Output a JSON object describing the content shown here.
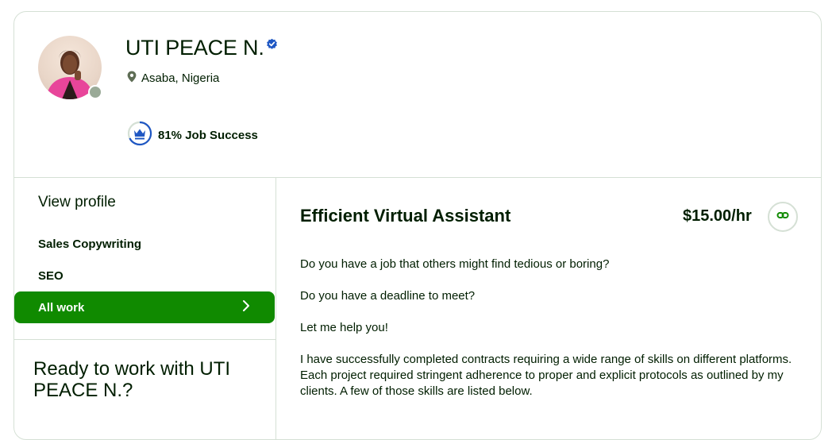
{
  "profile": {
    "name": "UTI PEACE N.",
    "location": "Asaba, Nigeria",
    "job_success": "81% Job Success"
  },
  "sidebar": {
    "view_profile": "View profile",
    "items": [
      {
        "label": "Sales Copywriting"
      },
      {
        "label": "SEO"
      },
      {
        "label": "All work"
      }
    ],
    "ready_title": "Ready to work with UTI PEACE N.?"
  },
  "main": {
    "title": "Efficient Virtual Assistant",
    "rate": "$15.00/hr",
    "description": [
      "Do you have a job that others might find tedious or boring?",
      "Do you have a deadline to meet?",
      "Let me help you!",
      "I have successfully completed contracts requiring a wide range of skills on different platforms. Each project required stringent adherence to proper and explicit protocols as outlined by my clients. A few of those skills are listed below."
    ]
  },
  "colors": {
    "brand_green": "#108a00",
    "verified_blue": "#1f57c3",
    "border": "#d5e0d5",
    "text": "#001e00"
  },
  "icons": [
    "verified-badge-icon",
    "location-pin-icon",
    "job-success-crown-icon",
    "chevron-right-icon",
    "link-icon"
  ]
}
